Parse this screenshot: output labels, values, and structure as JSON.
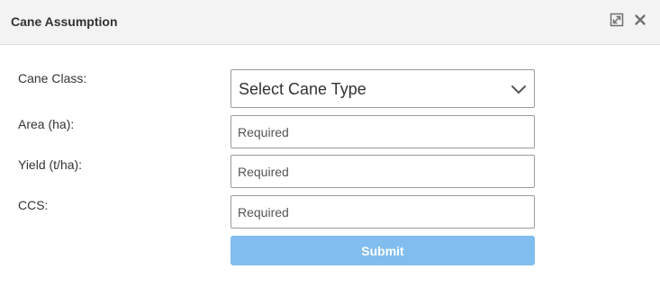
{
  "dialog": {
    "title": "Cane Assumption",
    "icons": [
      "expand-icon",
      "close-icon"
    ]
  },
  "form": {
    "cane_class": {
      "label": "Cane Class:",
      "selected": "Select Cane Type"
    },
    "area": {
      "label": "Area (ha):",
      "placeholder": "Required",
      "value": ""
    },
    "yield": {
      "label": "Yield (t/ha):",
      "placeholder": "Required",
      "value": ""
    },
    "ccs": {
      "label": "CCS:",
      "placeholder": "Required",
      "value": ""
    },
    "submit_label": "Submit"
  },
  "colors": {
    "titlebar_bg": "#f3f3f3",
    "submit_bg": "#81bdee",
    "field_border": "#9a9a9a"
  }
}
